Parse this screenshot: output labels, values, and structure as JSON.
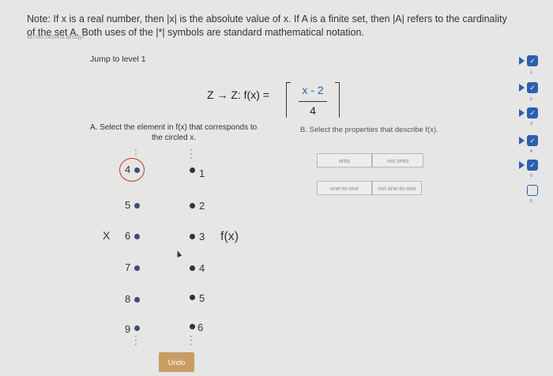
{
  "note": "Note: If x is a real number, then |x| is the absolute value of x. If A is a finite set, then |A| refers to the cardinality of the set A. Both uses of the |*| symbols are standard mathematical notation.",
  "faint_id": "437040.2435418.qx3zqy7",
  "jump": "Jump to level 1",
  "function": {
    "lhs": "Z → Z: f(x) =",
    "numerator": "x - 2",
    "denominator": "4"
  },
  "partA": {
    "line1": "A. Select the element in f(x) that corresponds to",
    "line2": "the circled x."
  },
  "partB": "B. Select the properties that describe f(x).",
  "options": {
    "onto": "onto",
    "not_onto": "not onto",
    "one_to_one": "one-to-one",
    "not_one_to_one": "not one-to-one"
  },
  "domain": {
    "label": "X",
    "elements": [
      "4",
      "5",
      "6",
      "7",
      "8",
      "9"
    ],
    "circled": "4"
  },
  "codomain": {
    "label": "f(x)",
    "elements": [
      "1",
      "2",
      "3",
      "4",
      "5",
      "6"
    ]
  },
  "undo": "Undo",
  "sidebar": {
    "steps": [
      "1",
      "2",
      "3",
      "4",
      "5",
      "6"
    ]
  },
  "colors": {
    "accent": "#2b5fb3",
    "undo": "#c79d63",
    "circle": "#c0392b"
  }
}
